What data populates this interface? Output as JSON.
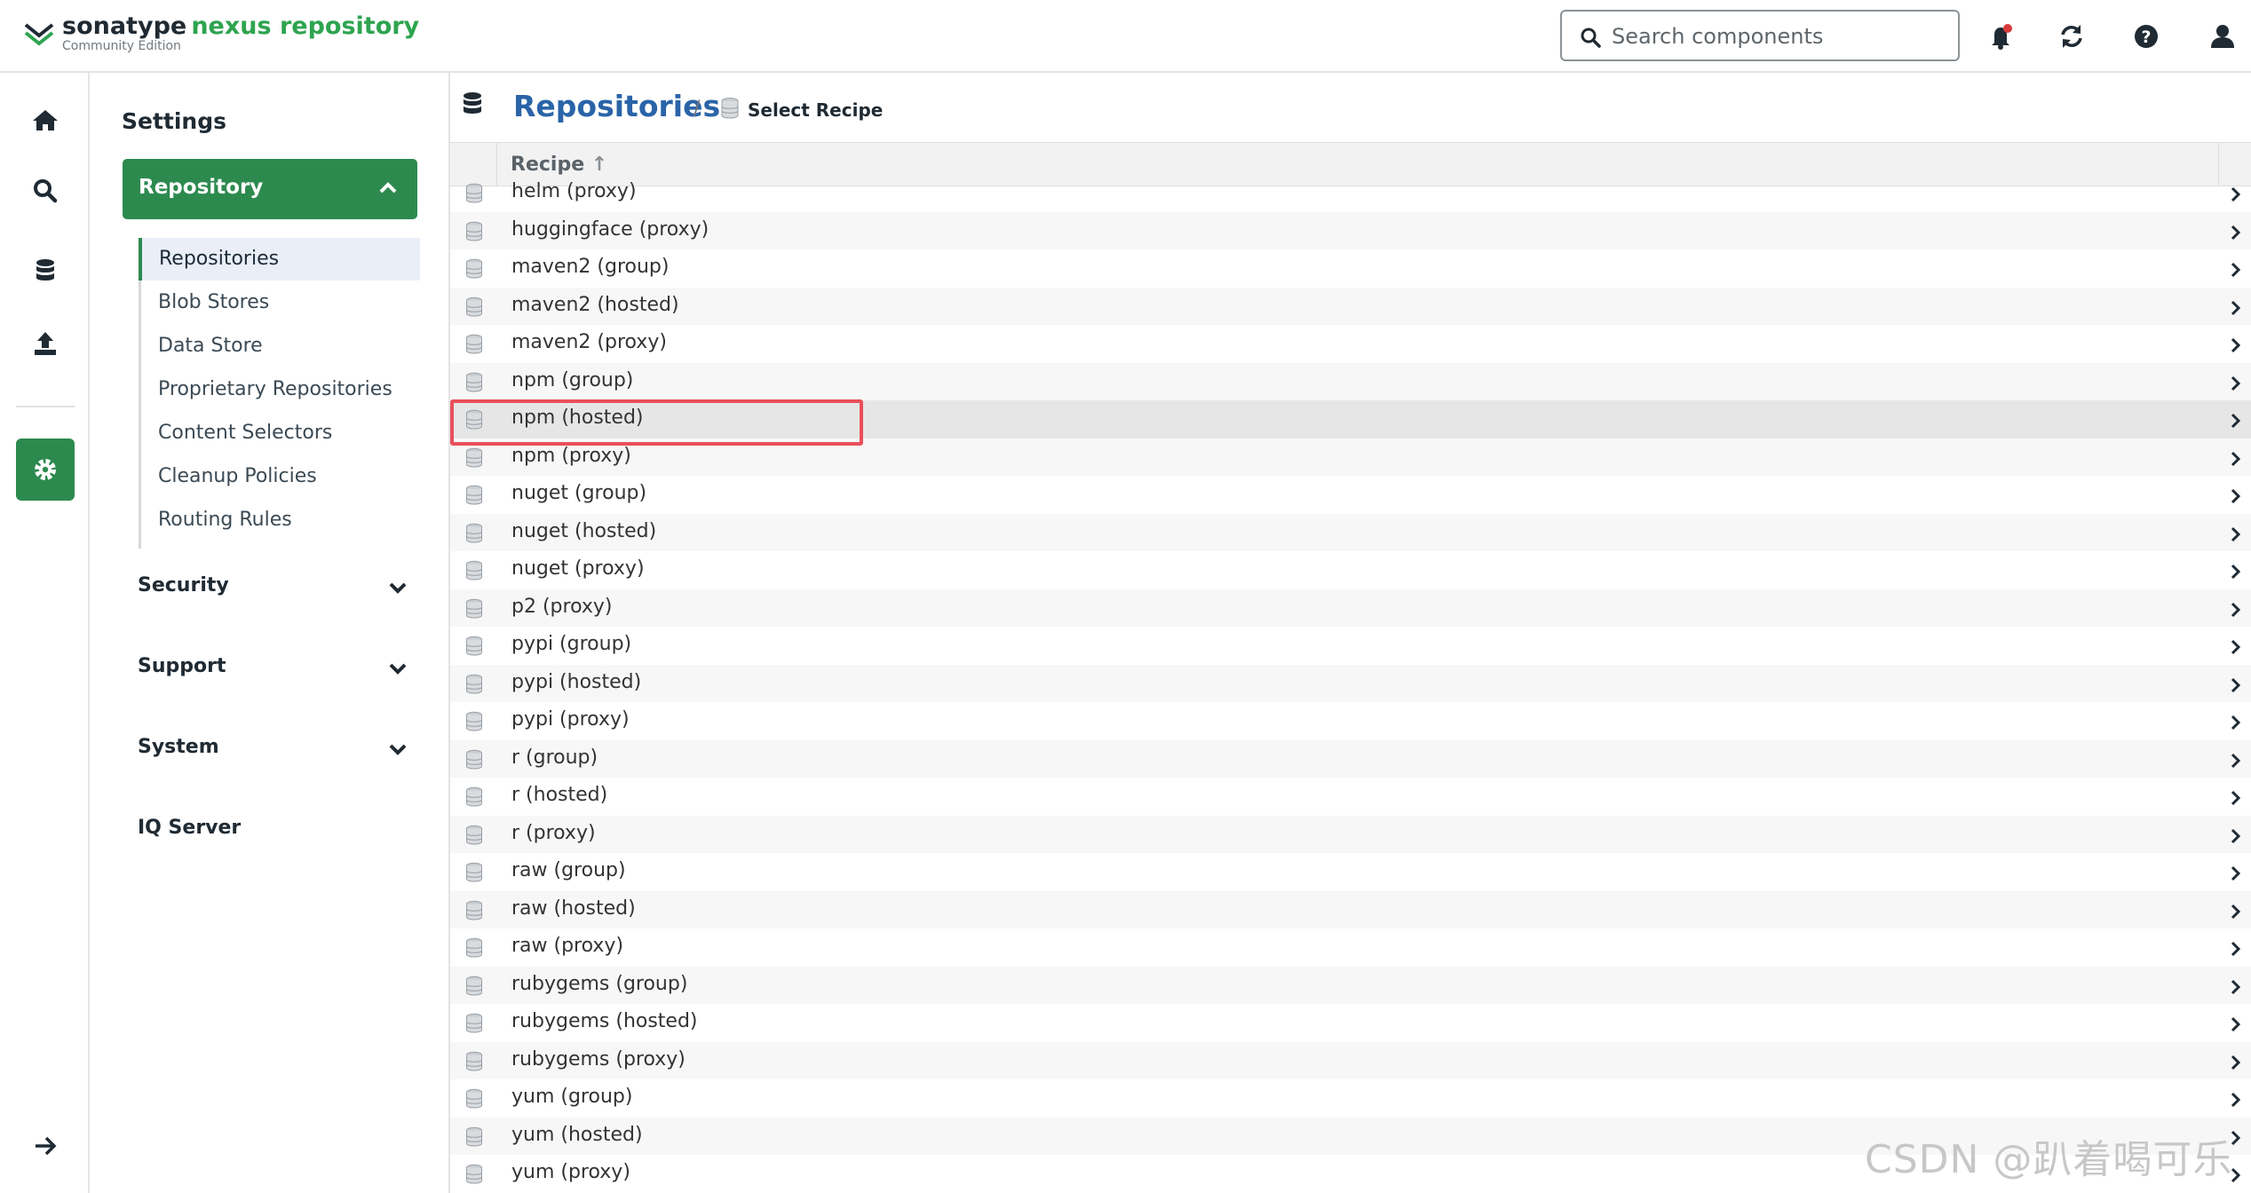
{
  "header": {
    "brand_primary": "sonatype",
    "brand_secondary": "nexus repository",
    "edition": "Community Edition",
    "search_placeholder": "Search components"
  },
  "icons": {
    "home": "home-icon",
    "search": "search-icon",
    "browse": "database-icon",
    "upload": "upload-icon",
    "admin": "gear-icon",
    "expand": "arrow-right-icon",
    "notifications": "bell-icon",
    "refresh": "refresh-icon",
    "help": "help-icon",
    "user": "user-icon"
  },
  "colors": {
    "accent_green": "#2d8a4f",
    "title_blue": "#2a64a8",
    "highlight_red": "#e8505b",
    "notification_dot": "#d83a3a"
  },
  "settings": {
    "title": "Settings",
    "repository_label": "Repository",
    "items": [
      {
        "label": "Repositories",
        "active": true
      },
      {
        "label": "Blob Stores"
      },
      {
        "label": "Data Store"
      },
      {
        "label": "Proprietary Repositories"
      },
      {
        "label": "Content Selectors"
      },
      {
        "label": "Cleanup Policies"
      },
      {
        "label": "Routing Rules"
      }
    ],
    "sections": [
      {
        "label": "Security",
        "expandable": true
      },
      {
        "label": "Support",
        "expandable": true
      },
      {
        "label": "System",
        "expandable": true
      },
      {
        "label": "IQ Server",
        "expandable": false
      }
    ]
  },
  "breadcrumb": {
    "title": "Repositories",
    "separator": "/",
    "current": "Select Recipe"
  },
  "grid": {
    "column_header": "Recipe",
    "sort_indicator": "↑",
    "selected_row": "npm (hosted)",
    "rows": [
      "helm (proxy)",
      "huggingface (proxy)",
      "maven2 (group)",
      "maven2 (hosted)",
      "maven2 (proxy)",
      "npm (group)",
      "npm (hosted)",
      "npm (proxy)",
      "nuget (group)",
      "nuget (hosted)",
      "nuget (proxy)",
      "p2 (proxy)",
      "pypi (group)",
      "pypi (hosted)",
      "pypi (proxy)",
      "r (group)",
      "r (hosted)",
      "r (proxy)",
      "raw (group)",
      "raw (hosted)",
      "raw (proxy)",
      "rubygems (group)",
      "rubygems (hosted)",
      "rubygems (proxy)",
      "yum (group)",
      "yum (hosted)",
      "yum (proxy)"
    ]
  },
  "watermark": "CSDN @趴着喝可乐"
}
